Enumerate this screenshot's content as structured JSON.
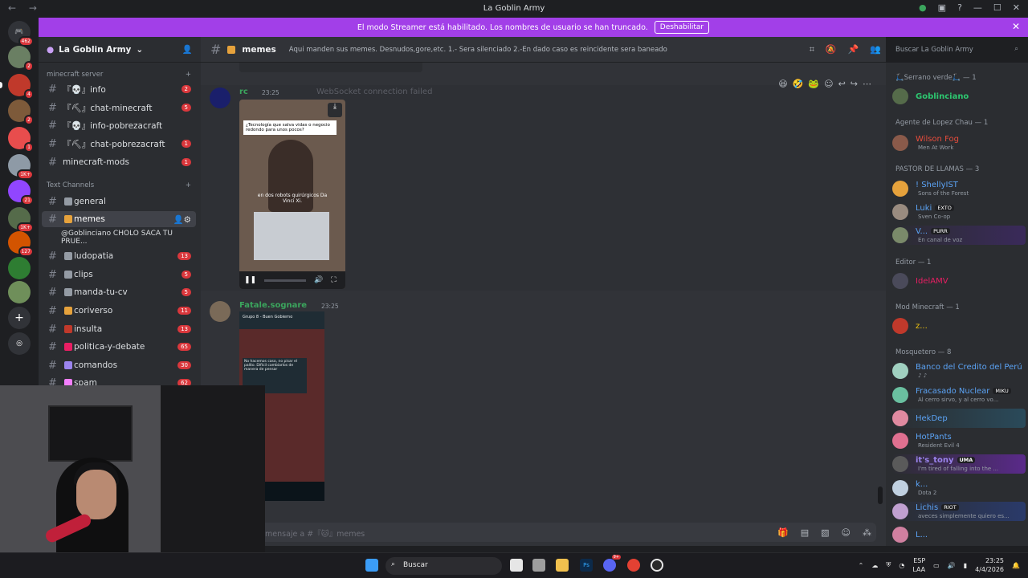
{
  "window": {
    "title": "La Goblin Army"
  },
  "banner": {
    "text": "El modo Streamer está habilitado. Los nombres de usuario se han truncado.",
    "button": "Deshabilitar"
  },
  "guilds": {
    "badges": [
      "462",
      "2",
      "4",
      "2",
      "1",
      "1K+",
      "21",
      "1K+",
      "127"
    ]
  },
  "server": {
    "name": "La Goblin Army"
  },
  "categories": {
    "minecraft": "minecraft server",
    "text": "Text Channels"
  },
  "channels": {
    "info": {
      "label": "『💀』info",
      "count": "2"
    },
    "chat_minecraft": {
      "label": "『⛏』chat-minecraft",
      "count": "5"
    },
    "info_pobreza": {
      "label": "『💀』info-pobrezacraft"
    },
    "chat_pobreza": {
      "label": "『⛏』chat-pobrezacraft",
      "count": "1"
    },
    "minecraft_mods": {
      "label": "minecraft-mods",
      "count": "1"
    },
    "general": {
      "label": "general"
    },
    "memes": {
      "label": "memes"
    },
    "thread": {
      "label": "@Goblinciano CHOLO SACA TU PRUE..."
    },
    "ludopatia": {
      "label": "ludopatia",
      "count": "13"
    },
    "clips": {
      "label": "clips",
      "count": "5"
    },
    "manda_tu_cv": {
      "label": "manda-tu-cv",
      "count": "5"
    },
    "coriverso": {
      "label": "coriverso",
      "count": "11"
    },
    "insulta": {
      "label": "insulta",
      "count": "13"
    },
    "politica": {
      "label": "politica-y-debate",
      "count": "65"
    },
    "comandos": {
      "label": "comandos",
      "count": "30"
    },
    "spam": {
      "label": "spam",
      "count": "62"
    }
  },
  "topbar": {
    "channel": "memes",
    "topic": "Aqui manden sus memes. Desnudos,gore,etc. 1.- Sera silenciado 2.-En dado caso es reincidente sera baneado"
  },
  "search": {
    "placeholder": "Buscar La Goblin Army"
  },
  "messages": [
    {
      "author": "rc",
      "time": "23:25",
      "overlay": "WebSocket connection failed",
      "video_caption": "¿Tecnología que salva vidas o negocio redondo para unos pocos?",
      "video_sub": "en dos robots quirúrgicos Da Vinci Xi."
    },
    {
      "author": "Fatale.sognare",
      "time": "23:25",
      "shot_header": "Grupo 8 - Buen Gobierno",
      "shot_text": "No hacemos caso, no pisar el palito. Difícil cambiarlos de manera de pensar"
    }
  ],
  "input": {
    "placeholder": "mensaje a #『🐱』memes"
  },
  "members": {
    "groups": [
      {
        "title": "🛴Serrano verde🛴 — 1"
      },
      {
        "title": "Agente de Lopez Chau — 1"
      },
      {
        "title": "PASTOR DE LLAMAS — 3"
      },
      {
        "title": "Editor — 1"
      },
      {
        "title": "Mod Minecraft — 1"
      },
      {
        "title": "Mosquetero — 8"
      }
    ],
    "list": [
      {
        "name": "Goblinciano",
        "status": "",
        "color": "#2dc770"
      },
      {
        "name": "Wilson Fog",
        "status": "Men At Work",
        "color": "#e74c3c"
      },
      {
        "name": "! ShellyIST",
        "status": "Sons of the Forest",
        "color": "#5ba3f5"
      },
      {
        "name": "Luki",
        "tag": "EXTO",
        "status": "Sven Co-op",
        "color": "#5ba3f5"
      },
      {
        "name": "V...",
        "tag": "PURR",
        "status": "En canal de voz",
        "color": "#5ba3f5"
      },
      {
        "name": "IdelAMV",
        "status": "",
        "color": "#e91e63"
      },
      {
        "name": "z...",
        "status": "",
        "color": "#f1c40f"
      },
      {
        "name": "Banco del Credito del Perú",
        "status": "♪ ♪",
        "color": "#5ba3f5"
      },
      {
        "name": "Fracasado Nuclear",
        "tag": "MIKU",
        "status": "Al cerro sirvo, y al cerro vo...",
        "color": "#5ba3f5"
      },
      {
        "name": "HekDep",
        "status": "",
        "color": "#5ba3f5"
      },
      {
        "name": "HotPants",
        "status": "Resident Evil 4",
        "color": "#5ba3f5"
      },
      {
        "name": "it's_tony",
        "tag": "UMA",
        "status": "I'm tired of falling into the ...",
        "color": "#9b84ee"
      },
      {
        "name": "k...",
        "status": "Dota 2",
        "color": "#5ba3f5"
      },
      {
        "name": "Lichis",
        "tag": "RIOT",
        "status": "aveces simplemente quiero es...",
        "color": "#5ba3f5"
      },
      {
        "name": "L...",
        "status": "",
        "color": "#5ba3f5"
      }
    ]
  },
  "taskbar": {
    "search": "Buscar",
    "lang1": "ESP",
    "lang2": "LAA",
    "time": "23:25",
    "date": "4/4/2026",
    "discord_badge": "9+"
  },
  "colors": {
    "accent": "#a23fe8",
    "blurple": "#5865f2",
    "alert": "#da373c"
  }
}
